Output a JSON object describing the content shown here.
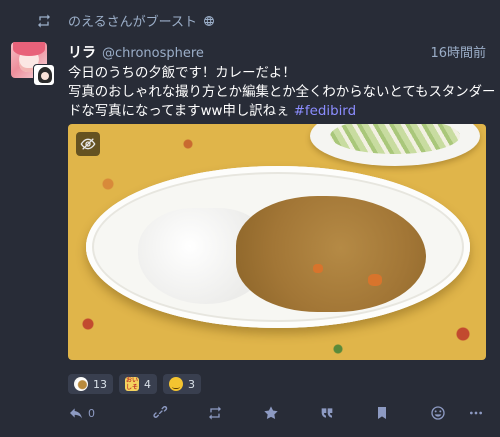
{
  "boost": {
    "text": "のえるさんがブースト",
    "icon": "boost-icon"
  },
  "status": {
    "display_name": "リラ",
    "acct": "@chronosphere",
    "time": "16時間前",
    "content_lines": [
      "今日のうちの夕飯です！カレーだよ！",
      "写真のおしゃれな撮り方とか編集とか全くわからないとてもスタンダー",
      "ドな写真になってますww申し訳ねぇ "
    ],
    "hashtag": "#fedibird"
  },
  "reactions": [
    {
      "emoji": "curry-rice-emoji",
      "count": "13"
    },
    {
      "emoji": "oishii-emoji",
      "label": "おい\nしそ",
      "count": "4"
    },
    {
      "emoji": "smiling-face-emoji",
      "count": "3"
    }
  ],
  "actions": {
    "reply_count": "0"
  },
  "colors": {
    "background": "#282c37",
    "secondary_text": "#9baec8",
    "hashtag": "#8c8dff",
    "icon": "#8d9ac2",
    "reaction_bg": "#393f4f"
  }
}
